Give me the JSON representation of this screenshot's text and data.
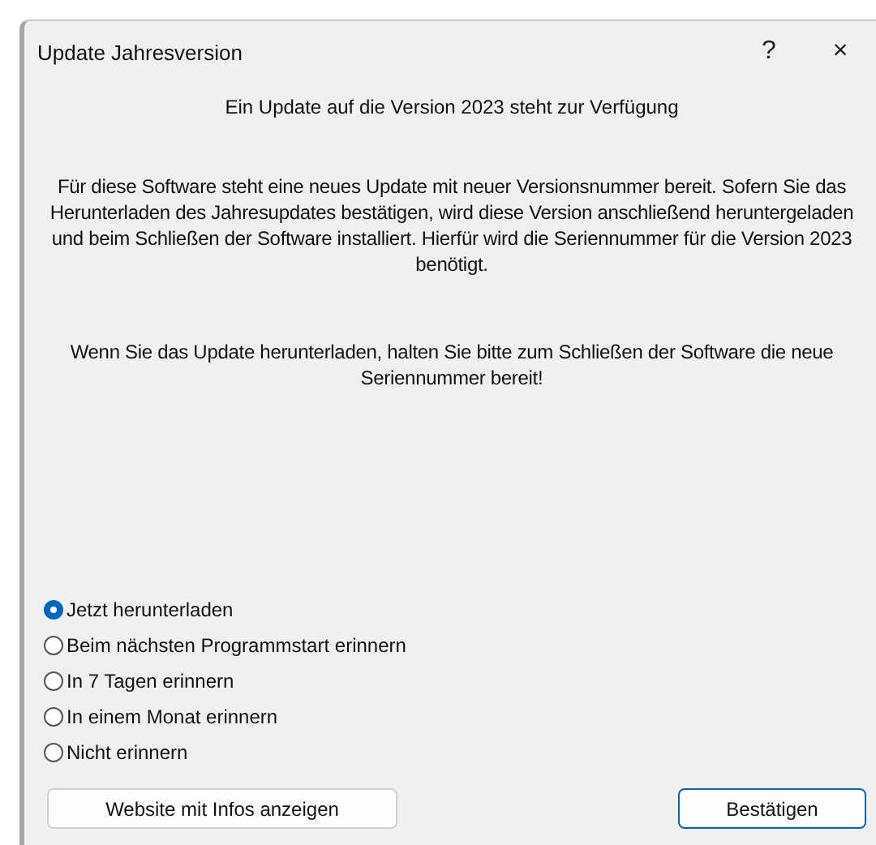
{
  "window": {
    "title": "Update Jahresversion",
    "help": "?",
    "close": "×"
  },
  "heading": "Ein Update auf die Version 2023 steht zur Verfügung",
  "paragraphs": [
    "Für diese Software steht eine neues Update mit neuer Versionsnummer bereit. Sofern Sie das Herunterladen des Jahresupdates bestätigen, wird diese Version anschließend heruntergeladen und beim Schließen der Software installiert. Hierfür wird die Seriennummer für die Version 2023 benötigt.",
    "Wenn Sie das Update herunterladen, halten Sie bitte zum Schließen der Software die neue Seriennummer bereit!"
  ],
  "options": [
    {
      "label": "Jetzt herunterladen",
      "selected": true
    },
    {
      "label": "Beim nächsten Programmstart erinnern",
      "selected": false
    },
    {
      "label": "In 7 Tagen erinnern",
      "selected": false
    },
    {
      "label": "In einem Monat erinnern",
      "selected": false
    },
    {
      "label": "Nicht erinnern",
      "selected": false
    }
  ],
  "buttons": [
    {
      "label": "Website mit Infos anzeigen",
      "kind": "secondary"
    },
    {
      "label": "Bestätigen",
      "kind": "default"
    }
  ]
}
